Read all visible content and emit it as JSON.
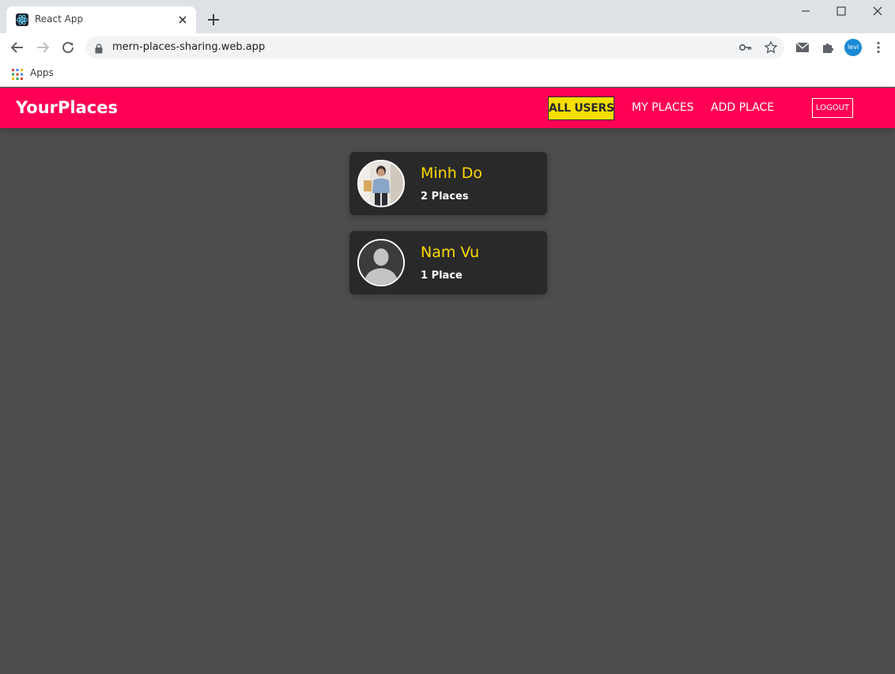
{
  "browser": {
    "tab_title": "React App",
    "url": "mern-places-sharing.web.app",
    "bookmarks": {
      "apps_label": "Apps"
    },
    "profile_initials": "levi"
  },
  "header": {
    "brand": "YourPlaces",
    "nav": {
      "all_users": "ALL USERS",
      "my_places": "MY PLACES",
      "add_place": "ADD PLACE",
      "logout": "LOGOUT"
    }
  },
  "users": [
    {
      "name": "Minh Do",
      "places": "2 Places",
      "avatar": "photo"
    },
    {
      "name": "Nam Vu",
      "places": "1 Place",
      "avatar": "default-silhouette"
    }
  ],
  "colors": {
    "header_bg": "#ff0055",
    "active_nav_bg": "#f8df00",
    "card_bg": "#292929",
    "page_bg": "#4d4d4d",
    "name_color": "#ffd900"
  },
  "icons": [
    "react-favicon",
    "close-icon",
    "plus-icon",
    "minimize-icon",
    "maximize-icon",
    "window-close-icon",
    "back-arrow-icon",
    "forward-arrow-icon",
    "reload-icon",
    "lock-icon",
    "key-icon",
    "star-icon",
    "mail-icon",
    "puzzle-icon",
    "kebab-menu-icon",
    "apps-grid-icon",
    "person-silhouette-icon"
  ]
}
